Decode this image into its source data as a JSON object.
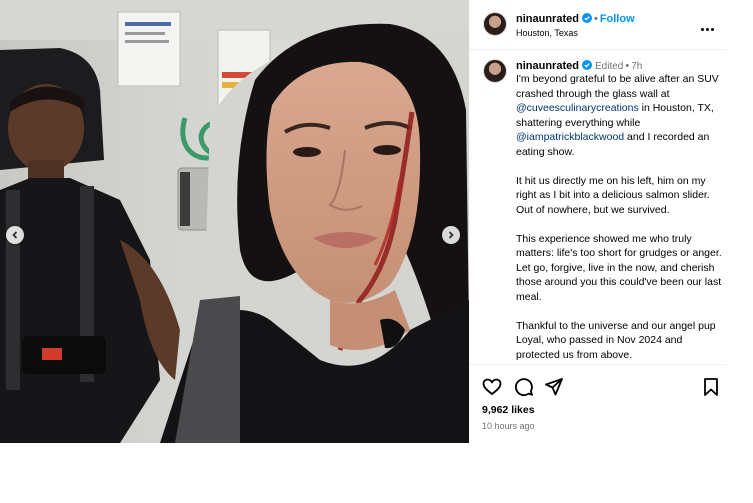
{
  "post": {
    "username": "ninaunrated",
    "follow_label": "Follow",
    "location": "Houston, Texas",
    "edited_label": "Edited",
    "age": "7h",
    "caption_parts": [
      "I'm beyond grateful to be alive after an SUV crashed through the glass wall at ",
      "@cuveesculinarycreations",
      " in Houston, TX, shattering everything while ",
      "@iampatrickblackwood",
      " and I recorded an eating show.\n\nIt hit us directly me on his left, him on my right as I bit into a delicious salmon slider. Out of nowhere, but we survived.\n\nThis experience showed me who truly matters: life's too short for grudges or anger. Let go, forgive, live in the now, and cherish those around you this could've been our last meal.\n\nThankful to the universe and our angel pup Loyal, who passed in Nov 2024 and protected us from above."
    ],
    "likes": "9,962 likes",
    "timestamp": "10 hours ago"
  },
  "icons": {
    "verified": "verified-badge-icon",
    "more": "more-options-icon",
    "like": "heart-icon",
    "comment": "comment-icon",
    "share": "send-icon",
    "save": "bookmark-icon",
    "prev": "chevron-left-icon",
    "next": "chevron-right-icon"
  },
  "colors": {
    "accent": "#0095f6",
    "mention": "#00376b",
    "muted": "#737373"
  }
}
